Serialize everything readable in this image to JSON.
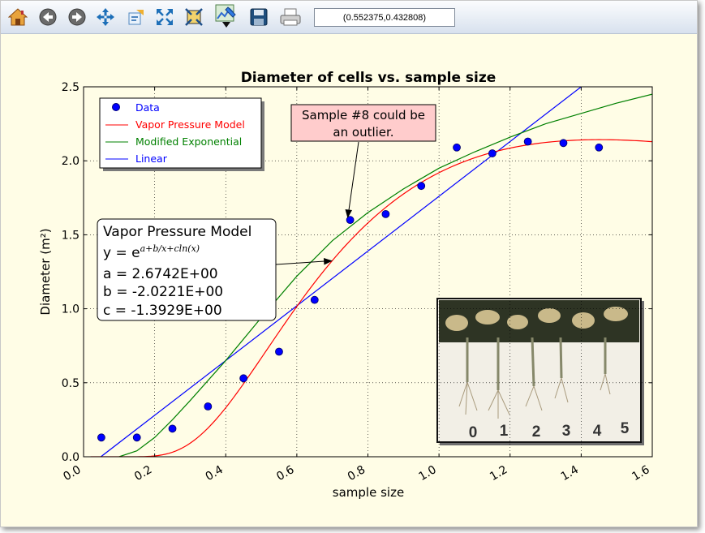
{
  "toolbar": {
    "buttons": [
      {
        "name": "home-button",
        "icon": "home-icon"
      },
      {
        "name": "back-button",
        "icon": "arrow-left-icon"
      },
      {
        "name": "forward-button",
        "icon": "arrow-right-icon"
      },
      {
        "name": "pan-button",
        "icon": "move-icon"
      },
      {
        "name": "zoom-rect-button",
        "icon": "zoom-rect-icon"
      },
      {
        "name": "fit-view-button",
        "icon": "expand-icon"
      },
      {
        "name": "configure-subplots-button",
        "icon": "subplots-icon"
      },
      {
        "name": "edit-button",
        "icon": "edit-icon"
      },
      {
        "name": "save-button",
        "icon": "save-icon"
      },
      {
        "name": "print-button",
        "icon": "print-icon"
      }
    ],
    "coords_text": "(0.552375,0.432808)"
  },
  "chart_data": {
    "type": "scatter",
    "title": "Diameter of cells vs. sample size",
    "xlabel": "sample size",
    "ylabel": "Diameter (m²)",
    "xlim": [
      0.0,
      1.6
    ],
    "ylim": [
      0.0,
      2.5
    ],
    "x_ticks": [
      "0.0",
      "0.2",
      "0.4",
      "0.6",
      "0.8",
      "1.0",
      "1.2",
      "1.4",
      "1.6"
    ],
    "y_ticks": [
      "0.0",
      "0.5",
      "1.0",
      "1.5",
      "2.0",
      "2.5"
    ],
    "grid": true,
    "legend_position": "top-left",
    "series": [
      {
        "name": "Data",
        "kind": "points",
        "color": "#0000ff",
        "x": [
          0.05,
          0.15,
          0.25,
          0.35,
          0.45,
          0.55,
          0.65,
          0.75,
          0.85,
          0.95,
          1.05,
          1.15,
          1.25,
          1.35,
          1.45
        ],
        "y": [
          0.13,
          0.13,
          0.19,
          0.34,
          0.53,
          0.71,
          1.06,
          1.6,
          1.64,
          1.83,
          2.09,
          2.05,
          2.13,
          2.12,
          2.09
        ]
      },
      {
        "name": "Vapor Pressure Model",
        "kind": "line",
        "color": "#ff0000",
        "a": 2.6742,
        "b": -2.0221,
        "c": -1.3929
      },
      {
        "name": "Modified Exponential",
        "kind": "line",
        "color": "#008000",
        "x": [
          0.1,
          0.15,
          0.2,
          0.25,
          0.3,
          0.4,
          0.5,
          0.6,
          0.7,
          0.8,
          0.9,
          1.0,
          1.1,
          1.2,
          1.3,
          1.4,
          1.5,
          1.6
        ],
        "y": [
          0.0,
          0.04,
          0.13,
          0.25,
          0.38,
          0.65,
          0.94,
          1.22,
          1.46,
          1.65,
          1.81,
          1.95,
          2.06,
          2.16,
          2.25,
          2.32,
          2.39,
          2.45
        ]
      },
      {
        "name": "Linear",
        "kind": "line",
        "color": "#0000ff",
        "slope": 1.85,
        "intercept": -0.09
      }
    ],
    "annotations": [
      {
        "text": [
          "Sample #8 could be",
          "an outlier."
        ],
        "point": [
          0.75,
          1.6
        ]
      },
      {
        "lines": [
          "Vapor Pressure Model",
          "y = e",
          "a = 2.6742E+00",
          "b = -2.0221E+00",
          "c = -1.3929E+00"
        ],
        "exponent": "a+b/x+cln(x)",
        "point": [
          0.7,
          1.32
        ]
      }
    ],
    "inset_image": {
      "name": "plant-roots-photo",
      "labels": [
        "0",
        "1",
        "2",
        "3",
        "4",
        "5"
      ]
    }
  }
}
